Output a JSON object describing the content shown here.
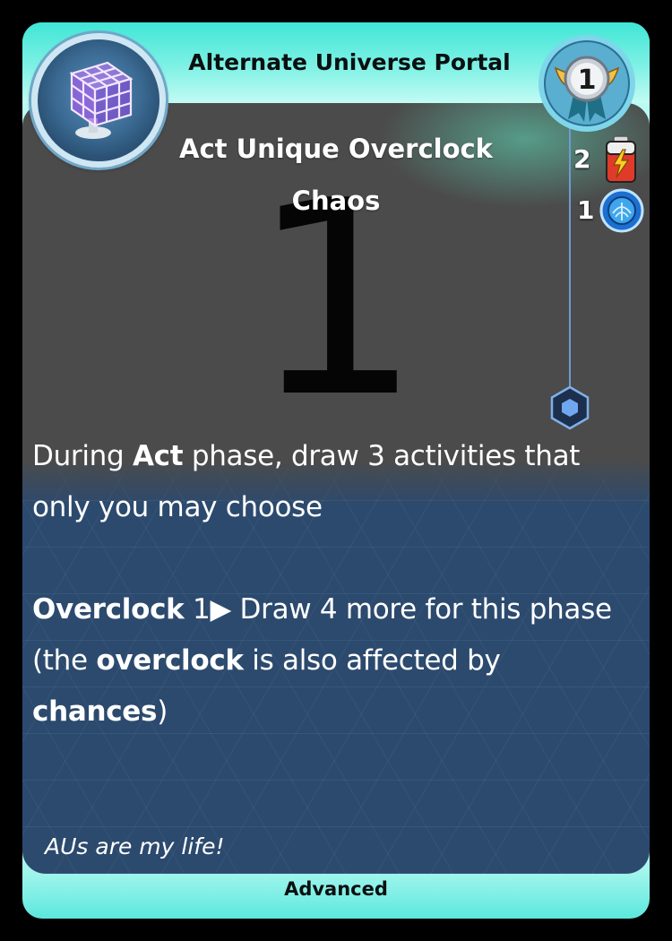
{
  "card": {
    "title": "Alternate Universe Portal",
    "tags_line1": "Act Unique Overclock",
    "tags_line2": "Chaos",
    "art_placeholder_number": "1",
    "level": "1",
    "costs": [
      {
        "value": "2",
        "icon": "battery-icon"
      },
      {
        "value": "1",
        "icon": "blue-token-icon"
      }
    ],
    "rules": {
      "p1_start": "During ",
      "p1_bold": "Act",
      "p1_end": " phase, draw 3 activities that only you may choose",
      "p2_bold1": "Overclock",
      "p2_mid": " 1",
      "p2_arrow": "▶",
      "p2_text": " Draw 4 more for this phase (the ",
      "p2_bold2": "overclock",
      "p2_text2": " is also affected by ",
      "p2_bold3": "chances",
      "p2_end": ")"
    },
    "flavor": "AUs are my life!",
    "rarity": "Advanced"
  },
  "colors": {
    "frame": "#40e6d6",
    "art_bg": "#4b4b4b",
    "text_bg": "#2c4a6e",
    "accent_blue": "#6f9ad0"
  }
}
